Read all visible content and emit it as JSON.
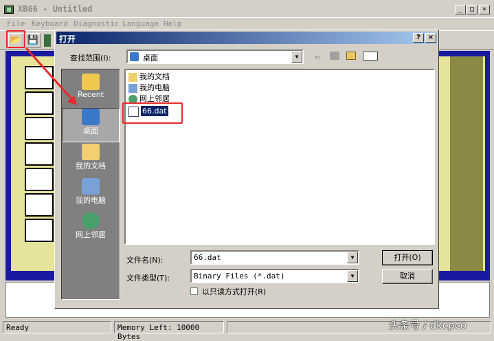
{
  "app": {
    "title": "XB66 - Untitled",
    "min": "_",
    "max": "□",
    "close": "×"
  },
  "menu": [
    "File",
    "Keyboard",
    "Diagnostic",
    "Language",
    "Help"
  ],
  "toolbar": {
    "open_icon": "📂",
    "save_icon": "💾"
  },
  "status": {
    "ready": "Ready",
    "memory": "Memory Left:  10000 Bytes"
  },
  "dialog": {
    "title": "打开",
    "help": "?",
    "close": "×",
    "look_in_label": "查找范围(I):",
    "look_in_value": "桌面",
    "places": [
      {
        "label": "Recent"
      },
      {
        "label": "桌面"
      },
      {
        "label": "我的文档"
      },
      {
        "label": "我的电脑"
      },
      {
        "label": "网上邻居"
      }
    ],
    "files": [
      {
        "name": "我的文档"
      },
      {
        "name": "我的电脑"
      },
      {
        "name": "网上邻居"
      },
      {
        "name": "66.dat"
      }
    ],
    "filename_label": "文件名(N):",
    "filename_value": "66.dat",
    "filetype_label": "文件类型(T):",
    "filetype_value": "Binary Files (*.dat)",
    "readonly_label": "以只读方式打开(R)",
    "open_button": "打开(O)",
    "cancel_button": "取消"
  },
  "watermark": "头条号 / dkcpco",
  "colors": {
    "highlight": "#e8282c",
    "workarea": "#1a1aa0",
    "panel": "#e6e39a",
    "selection": "#0a246a"
  }
}
